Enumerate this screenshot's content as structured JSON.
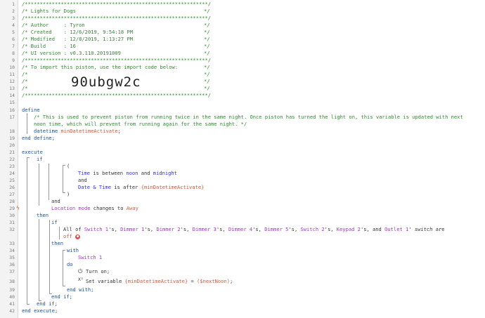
{
  "lines": {
    "l1": "/*************************************************************/",
    "l2a": "/* Lights for Dogs",
    "l2b": "*/",
    "l3": "/*************************************************************/",
    "l4a": "/* Author     : Tyron",
    "l4b": "*/",
    "l5a": "/* Created    : 12/6/2019, 9:54:18 PM",
    "l5b": "*/",
    "l6a": "/* Modified   : 12/8/2019, 1:13:27 PM",
    "l6b": "*/",
    "l7a": "/* Build      : 16",
    "l7b": "*/",
    "l8a": "/* UI version : v0.3.110.20191009",
    "l8b": "*/",
    "l9": "/*************************************************************/",
    "l10a": "/* To import this piston, use the import code below:",
    "l10b": "*/",
    "l11a": "/*",
    "l11b": "*/",
    "l12a": "/*",
    "l12b": "*/",
    "import_code": "90ubgw2c",
    "l13a": "/*",
    "l13b": "*/",
    "l14": "/*************************************************************/",
    "define": "define",
    "l17": "/* This is used to prevent piston from running twice in the same night. Once piston has turned the light on, this variable is updated with next",
    "l17b": "noon time, which will prevent from running again for the same night. */",
    "datetime": "datetime",
    "var_name": "minDatetimeActivate",
    "semicolon": ";",
    "end_define": "end define;",
    "execute": "execute",
    "if": "if",
    "paren_open": "(",
    "time": "Time",
    "is_between": " is between ",
    "noon": "noon",
    "and_word": " and ",
    "midnight": "midnight",
    "and": "and",
    "date_time": "Date & Time",
    "is_after": " is after ",
    "var_ref": "{minDatetimeActivate}",
    "paren_close": ")",
    "and2": "and",
    "location_mode": "Location mode",
    "changes_to": " changes to ",
    "away": "Away",
    "then": "then",
    "if2": "if",
    "all_of": "All of ",
    "devices": [
      {
        "name": "Switch 1",
        "sep": "'s, "
      },
      {
        "name": "Dimmer 1",
        "sep": "'s, "
      },
      {
        "name": "Dimmer 2",
        "sep": "'s, "
      },
      {
        "name": "Dimmer 3",
        "sep": "'s, "
      },
      {
        "name": "Dimmer 4",
        "sep": "'s, "
      },
      {
        "name": "Dimmer 5",
        "sep": "'s, "
      },
      {
        "name": "Switch 2",
        "sep": "'s, "
      },
      {
        "name": "Keypad 2",
        "sep": "'s, and "
      },
      {
        "name": "Outlet 1",
        "sep": "' "
      }
    ],
    "switch_attr": "switch",
    "are": " are",
    "off": "off",
    "then2": "then",
    "with": "with",
    "switch1": "Switch 1",
    "do": "do",
    "turn_on": "Turn on;",
    "set_variable": "Set variable ",
    "set_var_ref": "{minDatetimeActivate}",
    "equals": " = ",
    "next_noon": "($nextNoon)",
    "end_with": "end with;",
    "end_if_inner": "end if;",
    "end_if_outer": "end if;",
    "end_execute": "end execute;"
  },
  "numbers": [
    "1",
    "2",
    "3",
    "4",
    "5",
    "6",
    "7",
    "8",
    "9",
    "10",
    "11",
    "12",
    "13",
    "14",
    "15",
    "16",
    "17",
    "18",
    "19",
    "20",
    "21",
    "22",
    "23",
    "24",
    "25",
    "26",
    "27",
    "28",
    "29",
    "30",
    "31",
    "32",
    "33",
    "34",
    "35",
    "36",
    "37",
    "38",
    "39",
    "40",
    "41",
    "42"
  ],
  "icons": {
    "trigger": "lightning-icon",
    "power": "power-icon",
    "variable": "variable-x-icon",
    "badge": "off-badge-icon"
  },
  "colors": {
    "comment": "#2c8b2c",
    "keyword": "#1b4ea8",
    "attribute": "#2a2aff",
    "device": "#9b39c2",
    "variable": "#d4573b"
  }
}
